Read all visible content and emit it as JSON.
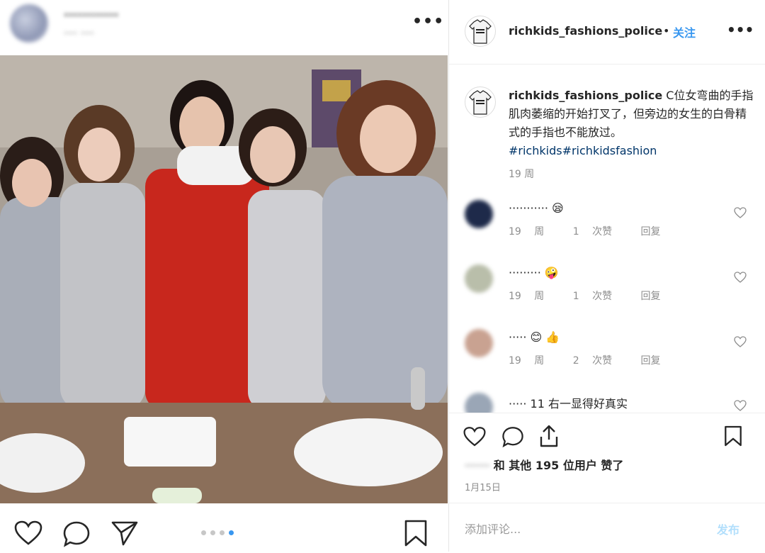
{
  "left": {
    "username": "············",
    "location": "···· ····",
    "more_icon": "more-horizontal-icon",
    "more_label": "•••",
    "actions": [
      "heart-icon",
      "comment-icon",
      "share-icon",
      "bookmark-icon"
    ],
    "carousel": {
      "total": 4,
      "active": 4
    }
  },
  "right": {
    "header": {
      "username": "richkids_fashions_police",
      "separator": "•",
      "follow_label": "关注",
      "more_label": "•••"
    },
    "caption": {
      "username": "richkids_fashions_police",
      "text": "C位女弯曲的手指肌肉萎缩的开始打叉了，但旁边的女生的白骨精式的手指也不能放过。",
      "hashtags": "#richkids#richkidsfashion",
      "time": "19 周"
    },
    "comments": [
      {
        "text": "··········· 😪",
        "time": "19 周",
        "likes": "1 次赞",
        "reply": "回复"
      },
      {
        "text": "········· 🤪",
        "time": "19 周",
        "likes": "1 次赞",
        "reply": "回复"
      },
      {
        "text": "····· 😊 👍",
        "time": "19 周",
        "likes": "2 次赞",
        "reply": "回复"
      },
      {
        "text": "····· 11 右一显得好真实"
      }
    ],
    "likes": {
      "prefix": "·······",
      "text": "和 其他 195 位用户 赞了"
    },
    "date": "1月15日",
    "add_comment_placeholder": "添加评论...",
    "post_label": "发布",
    "colors": {
      "accent": "#3897f0",
      "hashtag": "#003569",
      "muted": "#8e8e8e",
      "post_disabled": "#b2dffc"
    }
  }
}
